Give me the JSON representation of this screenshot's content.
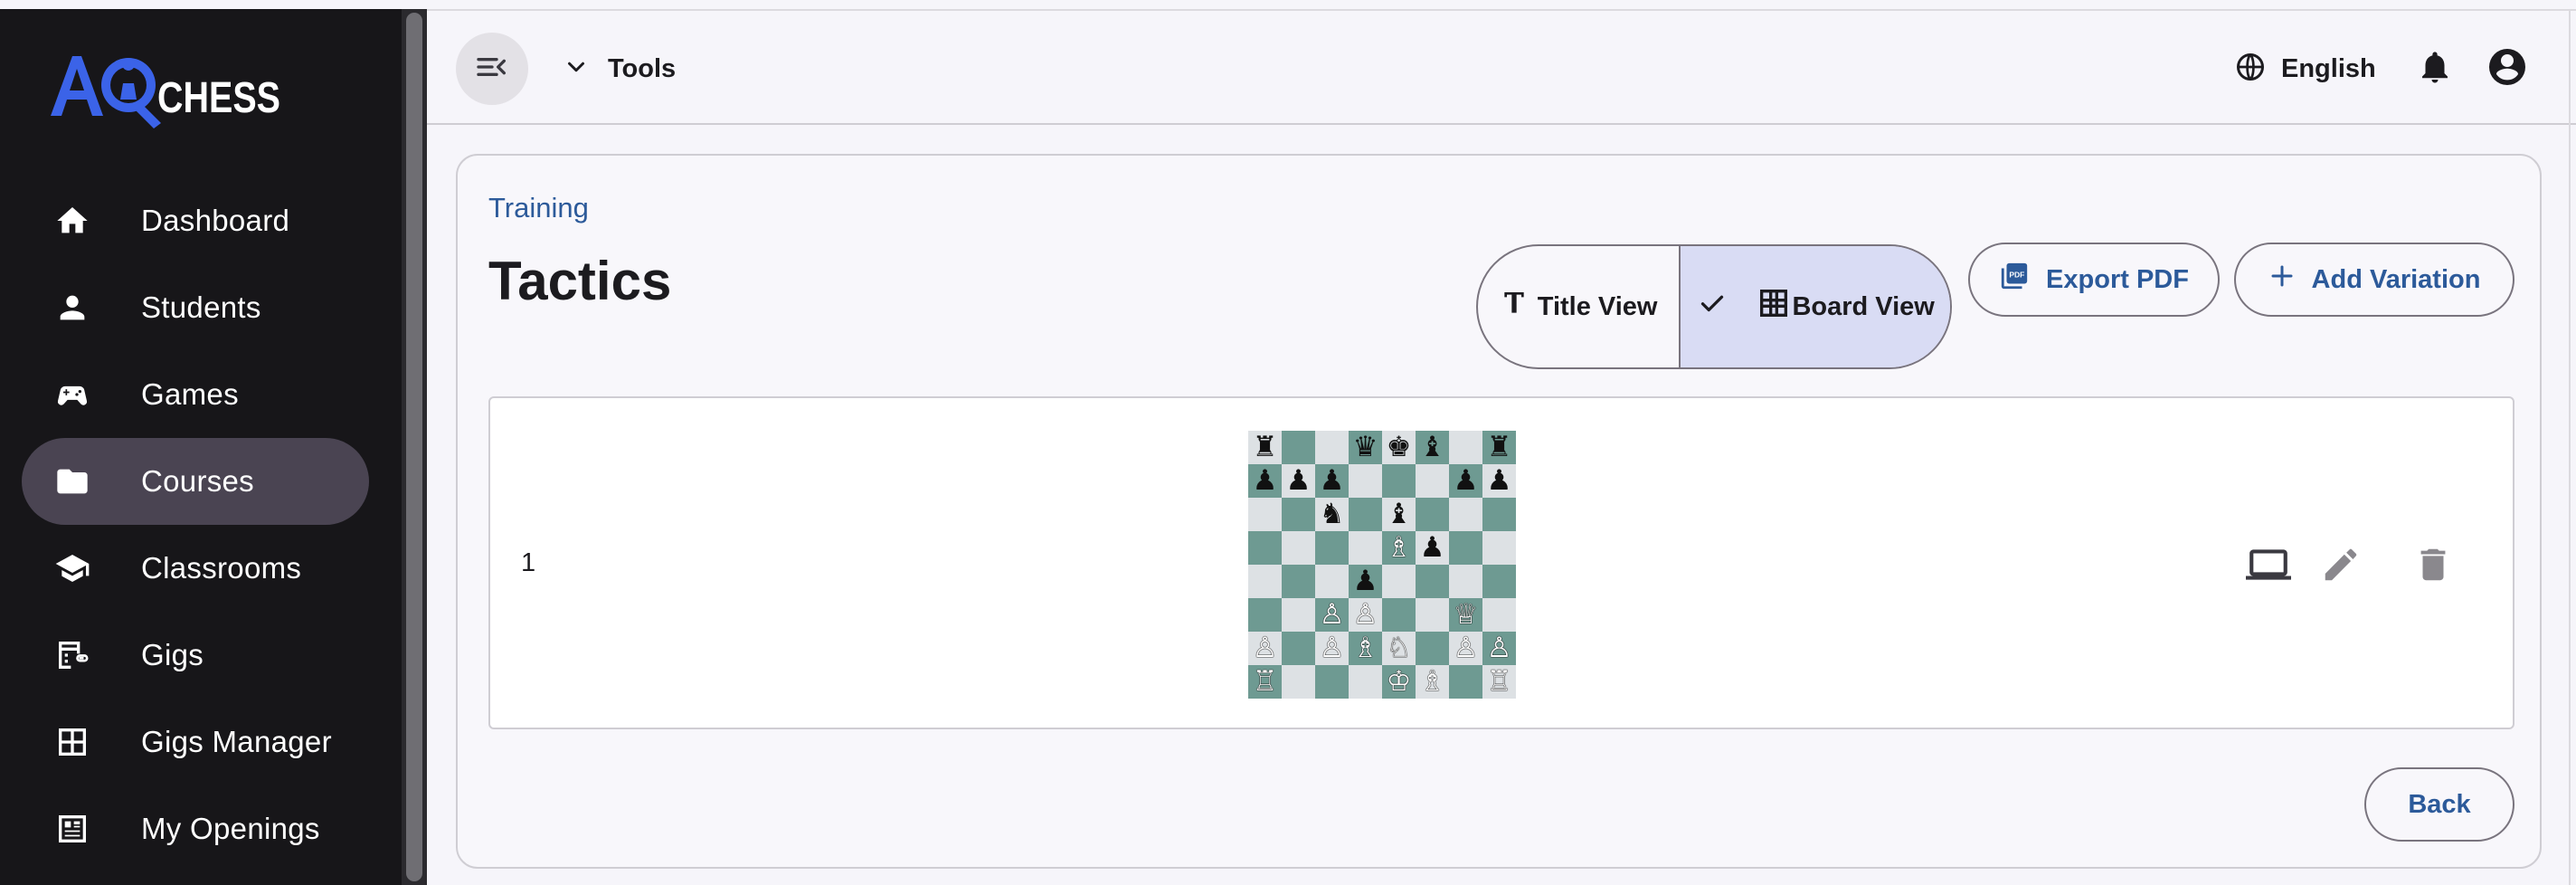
{
  "app": {
    "logo_text": "AQCHESS",
    "colors": {
      "brand_blue": "#3b63e8",
      "accent_text": "#2c5a9a",
      "sidebar_bg": "#171619",
      "active_nav": "#4a4452",
      "board_dark": "#6e9a92",
      "board_light": "#dde1e4"
    }
  },
  "sidebar": {
    "items": [
      {
        "label": "Dashboard",
        "icon": "home-icon",
        "active": false
      },
      {
        "label": "Students",
        "icon": "person-icon",
        "active": false
      },
      {
        "label": "Games",
        "icon": "gamepad-icon",
        "active": false
      },
      {
        "label": "Courses",
        "icon": "folder-icon",
        "active": true
      },
      {
        "label": "Classrooms",
        "icon": "school-icon",
        "active": false
      },
      {
        "label": "Gigs",
        "icon": "gigs-icon",
        "active": false
      },
      {
        "label": "Gigs Manager",
        "icon": "grid-icon",
        "active": false
      },
      {
        "label": "My Openings",
        "icon": "openings-icon",
        "active": false
      }
    ]
  },
  "topbar": {
    "menu_icon": "menu-collapse-icon",
    "tools_label": "Tools",
    "language_label": "English",
    "notification_icon": "bell-icon",
    "account_icon": "account-circle-icon"
  },
  "page": {
    "breadcrumb": "Training",
    "title": "Tactics",
    "view_toggle": {
      "title_view_label": "Title View",
      "board_view_label": "Board View",
      "selected": "Board View"
    },
    "export_label": "Export PDF",
    "add_variation_label": "Add Variation",
    "back_label": "Back"
  },
  "variations": [
    {
      "index": "1",
      "board_rows": [
        "r..qkb.r",
        "ppp...pp",
        "..n.b...",
        "....Bp..",
        "...p....",
        "..PP..Q.",
        "P.PBN.PP",
        "R...KB.R"
      ],
      "actions": [
        "laptop-icon",
        "edit-icon",
        "delete-icon"
      ]
    }
  ]
}
